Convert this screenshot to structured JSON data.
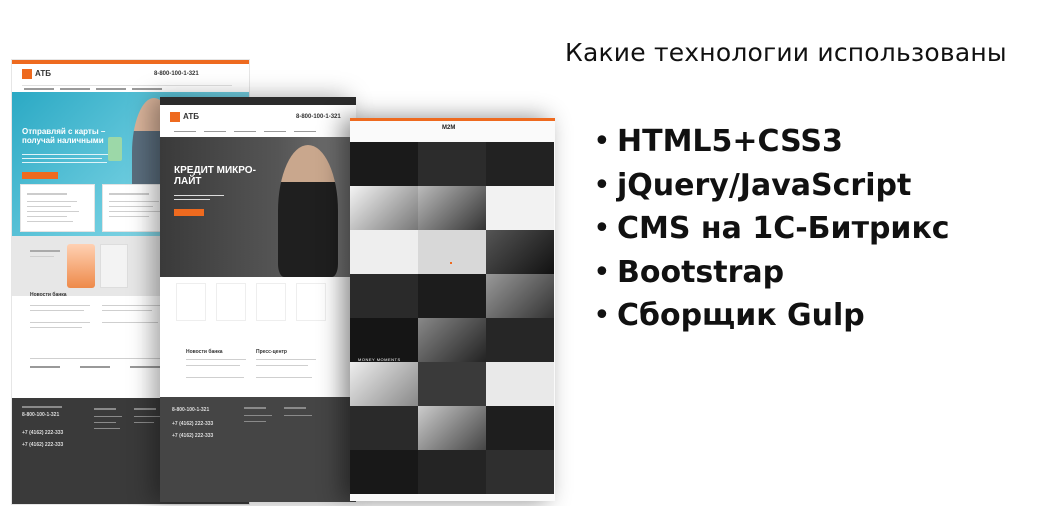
{
  "heading": "Какие технологии использованы",
  "bullet_char": "•",
  "technologies": [
    "HTML5+CSS3",
    "jQuery/JavaScript",
    "CMS на 1С-Битрикс",
    "Bootstrap",
    "Сборщик Gulp"
  ],
  "mockups": {
    "left": {
      "logo": "АТБ",
      "phone": "8-800-100-1-321",
      "hero_title": "Отправляй с карты – получай наличными",
      "news_title": "Новости банка",
      "footer_phone_1": "8-800-100-1-321",
      "footer_phone_2": "+7 (4162) 222-333",
      "footer_phone_3": "+7 (4162) 222-333"
    },
    "middle": {
      "logo": "АТБ",
      "phone": "8-800-100-1-321",
      "hero_title": "КРЕДИТ МИКРО-ЛАЙТ",
      "news_title": "Новости банка",
      "press_title": "Пресс-центр",
      "footer_phone_1": "8-800-100-1-321",
      "footer_phone_2": "+7 (4162) 222-333",
      "footer_phone_3": "+7 (4162) 222-333"
    },
    "right": {
      "logo": "M2M",
      "tile_caption": "MONEY MOMENTS"
    }
  },
  "colors": {
    "accent": "#ee6a1f",
    "text": "#111111",
    "dark_ui": "#2b2b2b"
  }
}
